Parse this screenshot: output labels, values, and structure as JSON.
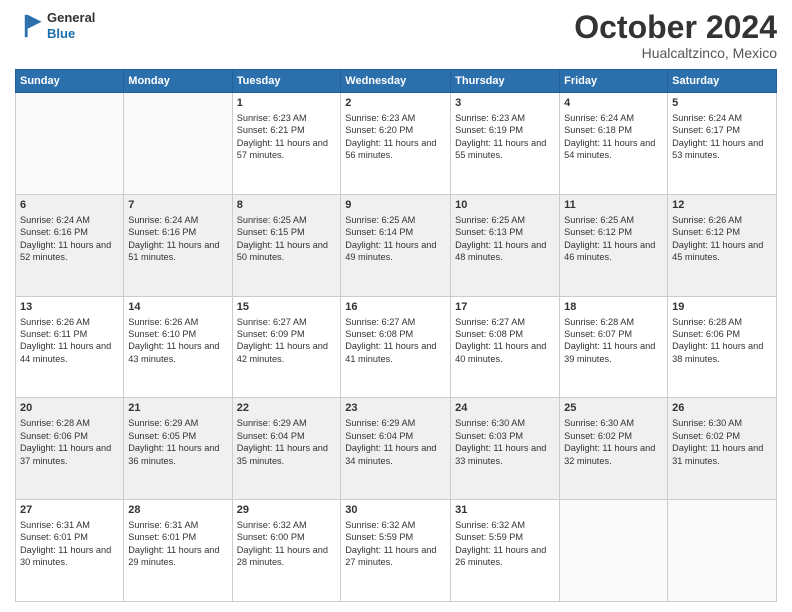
{
  "header": {
    "logo_general": "General",
    "logo_blue": "Blue",
    "title": "October 2024",
    "location": "Hualcaltzinco, Mexico"
  },
  "days": [
    "Sunday",
    "Monday",
    "Tuesday",
    "Wednesday",
    "Thursday",
    "Friday",
    "Saturday"
  ],
  "weeks": [
    [
      {
        "day": "",
        "sunrise": "",
        "sunset": "",
        "daylight": ""
      },
      {
        "day": "",
        "sunrise": "",
        "sunset": "",
        "daylight": ""
      },
      {
        "day": "1",
        "sunrise": "Sunrise: 6:23 AM",
        "sunset": "Sunset: 6:21 PM",
        "daylight": "Daylight: 11 hours and 57 minutes."
      },
      {
        "day": "2",
        "sunrise": "Sunrise: 6:23 AM",
        "sunset": "Sunset: 6:20 PM",
        "daylight": "Daylight: 11 hours and 56 minutes."
      },
      {
        "day": "3",
        "sunrise": "Sunrise: 6:23 AM",
        "sunset": "Sunset: 6:19 PM",
        "daylight": "Daylight: 11 hours and 55 minutes."
      },
      {
        "day": "4",
        "sunrise": "Sunrise: 6:24 AM",
        "sunset": "Sunset: 6:18 PM",
        "daylight": "Daylight: 11 hours and 54 minutes."
      },
      {
        "day": "5",
        "sunrise": "Sunrise: 6:24 AM",
        "sunset": "Sunset: 6:17 PM",
        "daylight": "Daylight: 11 hours and 53 minutes."
      }
    ],
    [
      {
        "day": "6",
        "sunrise": "Sunrise: 6:24 AM",
        "sunset": "Sunset: 6:16 PM",
        "daylight": "Daylight: 11 hours and 52 minutes."
      },
      {
        "day": "7",
        "sunrise": "Sunrise: 6:24 AM",
        "sunset": "Sunset: 6:16 PM",
        "daylight": "Daylight: 11 hours and 51 minutes."
      },
      {
        "day": "8",
        "sunrise": "Sunrise: 6:25 AM",
        "sunset": "Sunset: 6:15 PM",
        "daylight": "Daylight: 11 hours and 50 minutes."
      },
      {
        "day": "9",
        "sunrise": "Sunrise: 6:25 AM",
        "sunset": "Sunset: 6:14 PM",
        "daylight": "Daylight: 11 hours and 49 minutes."
      },
      {
        "day": "10",
        "sunrise": "Sunrise: 6:25 AM",
        "sunset": "Sunset: 6:13 PM",
        "daylight": "Daylight: 11 hours and 48 minutes."
      },
      {
        "day": "11",
        "sunrise": "Sunrise: 6:25 AM",
        "sunset": "Sunset: 6:12 PM",
        "daylight": "Daylight: 11 hours and 46 minutes."
      },
      {
        "day": "12",
        "sunrise": "Sunrise: 6:26 AM",
        "sunset": "Sunset: 6:12 PM",
        "daylight": "Daylight: 11 hours and 45 minutes."
      }
    ],
    [
      {
        "day": "13",
        "sunrise": "Sunrise: 6:26 AM",
        "sunset": "Sunset: 6:11 PM",
        "daylight": "Daylight: 11 hours and 44 minutes."
      },
      {
        "day": "14",
        "sunrise": "Sunrise: 6:26 AM",
        "sunset": "Sunset: 6:10 PM",
        "daylight": "Daylight: 11 hours and 43 minutes."
      },
      {
        "day": "15",
        "sunrise": "Sunrise: 6:27 AM",
        "sunset": "Sunset: 6:09 PM",
        "daylight": "Daylight: 11 hours and 42 minutes."
      },
      {
        "day": "16",
        "sunrise": "Sunrise: 6:27 AM",
        "sunset": "Sunset: 6:08 PM",
        "daylight": "Daylight: 11 hours and 41 minutes."
      },
      {
        "day": "17",
        "sunrise": "Sunrise: 6:27 AM",
        "sunset": "Sunset: 6:08 PM",
        "daylight": "Daylight: 11 hours and 40 minutes."
      },
      {
        "day": "18",
        "sunrise": "Sunrise: 6:28 AM",
        "sunset": "Sunset: 6:07 PM",
        "daylight": "Daylight: 11 hours and 39 minutes."
      },
      {
        "day": "19",
        "sunrise": "Sunrise: 6:28 AM",
        "sunset": "Sunset: 6:06 PM",
        "daylight": "Daylight: 11 hours and 38 minutes."
      }
    ],
    [
      {
        "day": "20",
        "sunrise": "Sunrise: 6:28 AM",
        "sunset": "Sunset: 6:06 PM",
        "daylight": "Daylight: 11 hours and 37 minutes."
      },
      {
        "day": "21",
        "sunrise": "Sunrise: 6:29 AM",
        "sunset": "Sunset: 6:05 PM",
        "daylight": "Daylight: 11 hours and 36 minutes."
      },
      {
        "day": "22",
        "sunrise": "Sunrise: 6:29 AM",
        "sunset": "Sunset: 6:04 PM",
        "daylight": "Daylight: 11 hours and 35 minutes."
      },
      {
        "day": "23",
        "sunrise": "Sunrise: 6:29 AM",
        "sunset": "Sunset: 6:04 PM",
        "daylight": "Daylight: 11 hours and 34 minutes."
      },
      {
        "day": "24",
        "sunrise": "Sunrise: 6:30 AM",
        "sunset": "Sunset: 6:03 PM",
        "daylight": "Daylight: 11 hours and 33 minutes."
      },
      {
        "day": "25",
        "sunrise": "Sunrise: 6:30 AM",
        "sunset": "Sunset: 6:02 PM",
        "daylight": "Daylight: 11 hours and 32 minutes."
      },
      {
        "day": "26",
        "sunrise": "Sunrise: 6:30 AM",
        "sunset": "Sunset: 6:02 PM",
        "daylight": "Daylight: 11 hours and 31 minutes."
      }
    ],
    [
      {
        "day": "27",
        "sunrise": "Sunrise: 6:31 AM",
        "sunset": "Sunset: 6:01 PM",
        "daylight": "Daylight: 11 hours and 30 minutes."
      },
      {
        "day": "28",
        "sunrise": "Sunrise: 6:31 AM",
        "sunset": "Sunset: 6:01 PM",
        "daylight": "Daylight: 11 hours and 29 minutes."
      },
      {
        "day": "29",
        "sunrise": "Sunrise: 6:32 AM",
        "sunset": "Sunset: 6:00 PM",
        "daylight": "Daylight: 11 hours and 28 minutes."
      },
      {
        "day": "30",
        "sunrise": "Sunrise: 6:32 AM",
        "sunset": "Sunset: 5:59 PM",
        "daylight": "Daylight: 11 hours and 27 minutes."
      },
      {
        "day": "31",
        "sunrise": "Sunrise: 6:32 AM",
        "sunset": "Sunset: 5:59 PM",
        "daylight": "Daylight: 11 hours and 26 minutes."
      },
      {
        "day": "",
        "sunrise": "",
        "sunset": "",
        "daylight": ""
      },
      {
        "day": "",
        "sunrise": "",
        "sunset": "",
        "daylight": ""
      }
    ]
  ]
}
